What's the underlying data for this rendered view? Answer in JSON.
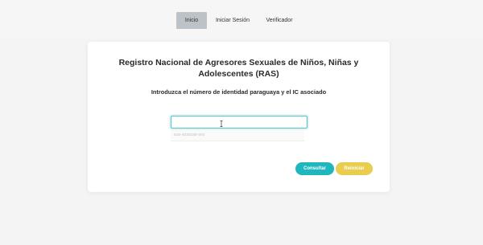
{
  "nav": {
    "items": [
      {
        "label": "Inicio",
        "active": true
      },
      {
        "label": "Iniciar Sesión",
        "active": false
      },
      {
        "label": "Verificador",
        "active": false
      }
    ]
  },
  "card": {
    "title": "Registro Nacional de Agresores Sexuales de Niños, Niñas y Adolescentes (RAS)",
    "subtitle": "Introduzca el número de identidad paraguaya y el IC asociado",
    "input_value": "",
    "hint": "016-4030189-004",
    "buttons": {
      "consultar": "Consultar",
      "reiniciar": "Reiniciar"
    }
  },
  "colors": {
    "active_nav": "#bcc3c8",
    "consultar": "#1fb6bd",
    "reiniciar": "#e8cd4e",
    "input_focus": "#57c2c8"
  }
}
